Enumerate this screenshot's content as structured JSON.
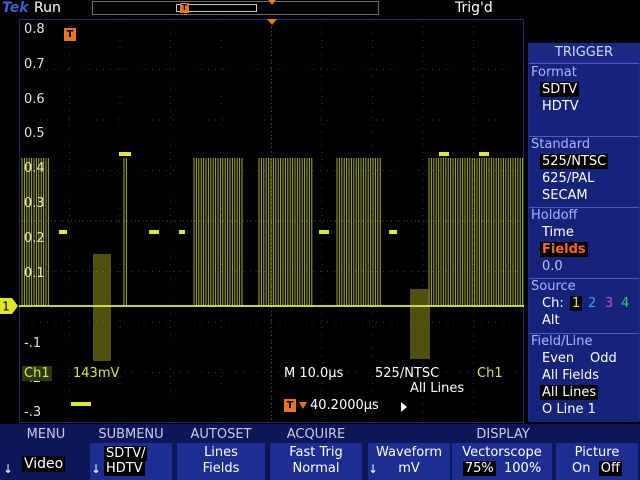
{
  "status": {
    "brand": "Tek",
    "run_state": "Run",
    "trigger_state": "Trig'd",
    "trigger_marker": "T"
  },
  "graticule": {
    "y_labels": [
      "0.8",
      "0.7",
      "0.6",
      "0.5",
      "0.4",
      "0.3",
      "0.2",
      "0.1",
      "",
      "-.1",
      "-.2",
      "-.3"
    ],
    "ground_marker": "1"
  },
  "readout": {
    "channel": "Ch1",
    "volts_per_div": "143mV",
    "time_per_div": "M 10.0µs",
    "standard": "525/NTSC",
    "source": "Ch1",
    "lines": "All Lines",
    "trigger_marker": "T",
    "delay": "40.2000µs"
  },
  "trigger_menu": {
    "title": "TRIGGER",
    "format": {
      "heading": "Format",
      "options": [
        "SDTV",
        "HDTV"
      ],
      "selected": "SDTV"
    },
    "standard": {
      "heading": "Standard",
      "options": [
        "525/NTSC",
        "625/PAL",
        "SECAM"
      ],
      "selected": "525/NTSC"
    },
    "holdoff": {
      "heading": "Holdoff",
      "options": [
        "Time",
        "Fields"
      ],
      "selected": "Fields",
      "value": "0.0"
    },
    "source": {
      "heading": "Source",
      "label": "Ch:",
      "channels": [
        "1",
        "2",
        "3",
        "4"
      ],
      "selected": "1",
      "alt": "Alt"
    },
    "field_line": {
      "heading": "Field/Line",
      "row1": [
        "Even",
        "Odd"
      ],
      "options": [
        "All Fields",
        "All Lines",
        "O Line 1"
      ],
      "selected": "All Lines"
    },
    "channel_colors": {
      "1": "#f0e62a",
      "2": "#2aa8f0",
      "3": "#c84ec8",
      "4": "#2ad070"
    }
  },
  "bottom_menu": {
    "headers": [
      "MENU",
      "SUBMENU",
      "AUTOSET",
      "ACQUIRE",
      "DISPLAY"
    ],
    "menu": "Video",
    "submenu": "SDTV/\nHDTV",
    "submenu_line1": "SDTV/",
    "submenu_line2": "HDTV",
    "autoset_line1": "Lines",
    "autoset_line2": "Fields",
    "acquire_line1": "Fast Trig",
    "acquire_line2": "Normal",
    "waveform_label": "Waveform",
    "waveform_value": "mV",
    "vectorscope_label": "Vectorscope",
    "vectorscope_options": [
      "75%",
      "100%"
    ],
    "picture_label": "Picture",
    "picture_options": [
      "On",
      "Off"
    ],
    "arrow": "↓"
  },
  "colors": {
    "trace": "#dfe82a",
    "accent_orange": "#e8761a",
    "menu_blue": "#1c2a86"
  }
}
